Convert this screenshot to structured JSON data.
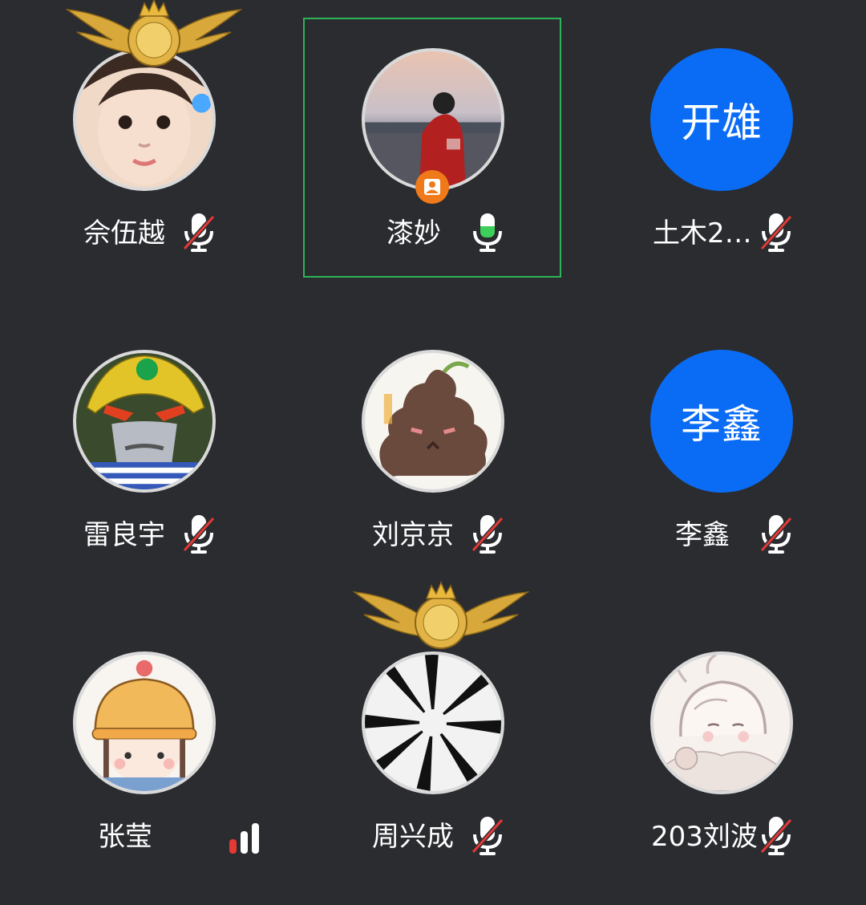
{
  "participants": [
    {
      "name": "佘伍越",
      "mic": "muted",
      "avatar": "photo-child-face"
    },
    {
      "name": "漆妙",
      "mic": "speaking",
      "avatar": "photo-person-seaside",
      "active": true,
      "badge": "host-person-icon"
    },
    {
      "name": "土木2…",
      "mic": "muted",
      "avatar_text": "开雄"
    },
    {
      "name": "雷良宇",
      "mic": "muted",
      "avatar": "photo-robot-hero"
    },
    {
      "name": "刘京京",
      "mic": "muted",
      "avatar": "drawing-poop-character"
    },
    {
      "name": "李鑫",
      "mic": "muted",
      "avatar_text": "李鑫"
    },
    {
      "name": "张莹",
      "mic": "none",
      "avatar": "drawing-girl-hat",
      "indicator": "signal-bars"
    },
    {
      "name": "周兴成",
      "mic": "muted",
      "avatar": "photo-bw-abstract"
    },
    {
      "name": "203刘波",
      "mic": "muted",
      "avatar": "drawing-anime-sketch"
    }
  ],
  "colors": {
    "background": "#2a2c30",
    "active_border": "#2fb35a",
    "letter_avatar": "#0a6cf5",
    "mute_slash": "#e53935",
    "speaking_level": "#3ccf5a",
    "host_badge": "#f07a1a",
    "signal_strong": "#e53935"
  }
}
